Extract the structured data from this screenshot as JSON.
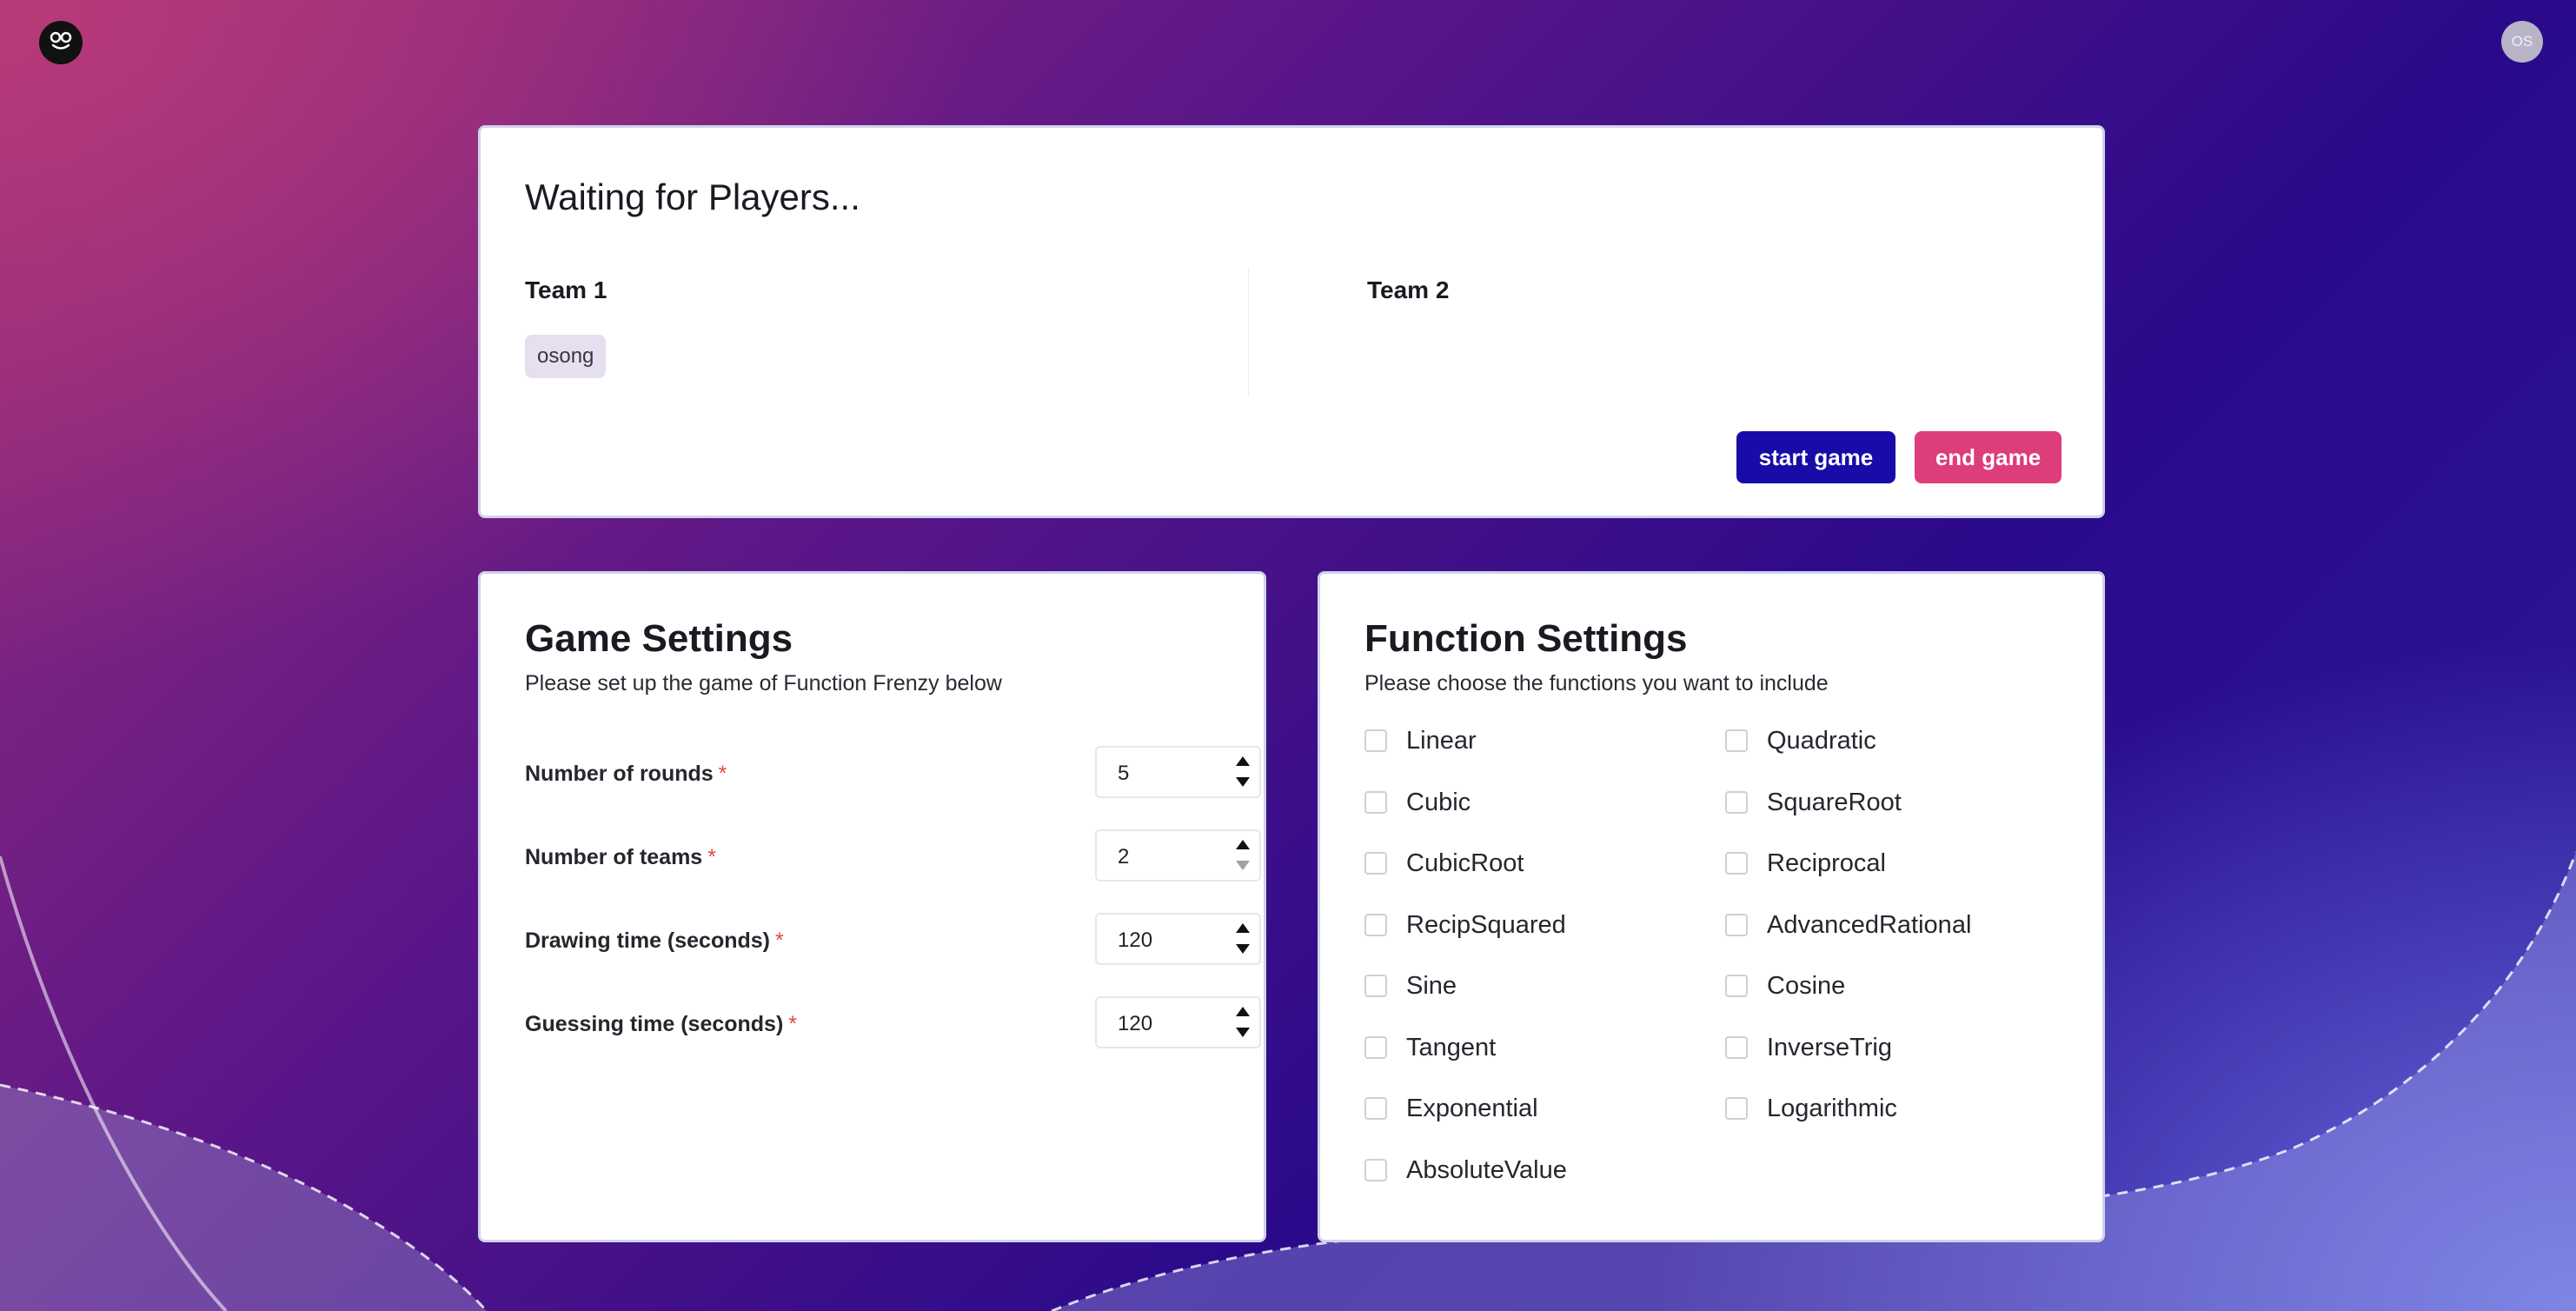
{
  "app": {
    "logo_icon": "smiley-icon",
    "avatar_initials": "OS"
  },
  "lobby": {
    "title": "Waiting for Players...",
    "teams": [
      {
        "name": "Team 1",
        "players": [
          "osong"
        ]
      },
      {
        "name": "Team 2",
        "players": []
      }
    ],
    "start_label": "start game",
    "end_label": "end game"
  },
  "game_settings": {
    "title": "Game Settings",
    "subtitle": "Please set up the game of Function Frenzy below",
    "fields": [
      {
        "label": "Number of rounds",
        "required_mark": "*",
        "value": "5"
      },
      {
        "label": "Number of teams",
        "required_mark": "*",
        "value": "2"
      },
      {
        "label": "Drawing time (seconds)",
        "required_mark": "*",
        "value": "120"
      },
      {
        "label": "Guessing time (seconds)",
        "required_mark": "*",
        "value": "120"
      }
    ]
  },
  "function_settings": {
    "title": "Function Settings",
    "subtitle": "Please choose the functions you want to include",
    "functions": [
      "Linear",
      "Quadratic",
      "Cubic",
      "SquareRoot",
      "CubicRoot",
      "Reciprocal",
      "RecipSquared",
      "AdvancedRational",
      "Sine",
      "Cosine",
      "Tangent",
      "InverseTrig",
      "Exponential",
      "Logarithmic",
      "AbsoluteValue"
    ]
  },
  "colors": {
    "start_button": "#180ca8",
    "end_button": "#dd3d7a",
    "player_chip": "#e6dff0",
    "required_star": "#e04a3a"
  }
}
